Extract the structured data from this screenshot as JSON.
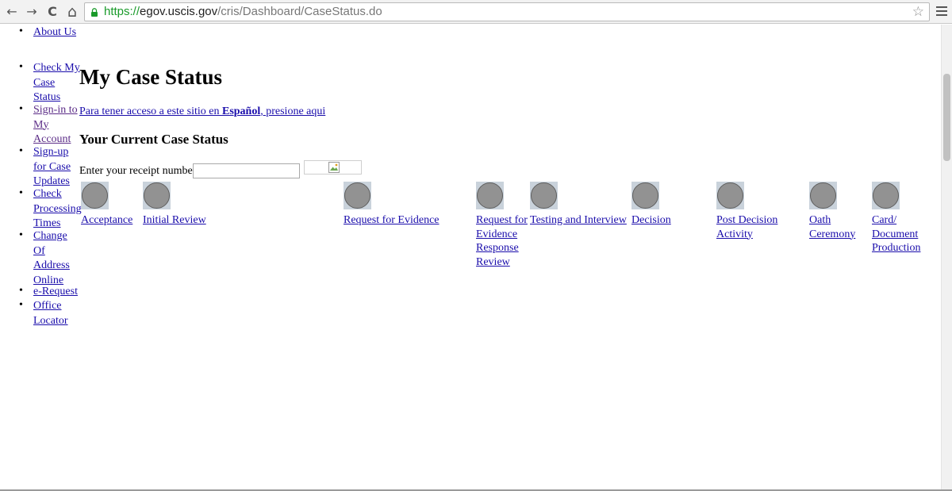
{
  "browser": {
    "url_scheme": "https://",
    "url_host": "egov.uscis.gov",
    "url_path": "/cris/Dashboard/CaseStatus.do",
    "icons": [
      "back-icon",
      "forward-icon",
      "reload-icon",
      "home-icon",
      "lock-icon",
      "bookmark-star-icon",
      "menu-icon"
    ],
    "back_glyph": "←",
    "forward_glyph": "→",
    "reload_glyph": "C",
    "home_glyph": "⌂",
    "star_glyph": "☆"
  },
  "nav": {
    "bullet": "•",
    "about_us": "About Us",
    "items": [
      {
        "lines": [
          "Check My",
          "Case",
          "Status"
        ]
      },
      {
        "lines": [
          "Sign-in to",
          "My",
          "Account"
        ]
      },
      {
        "lines": [
          "Sign-up",
          "for Case",
          "Updates"
        ]
      },
      {
        "lines": [
          "Check",
          "Processing",
          "Times"
        ]
      },
      {
        "lines": [
          "Change",
          "Of",
          "Address",
          "Online"
        ]
      },
      {
        "lines": [
          "e-Request"
        ]
      },
      {
        "lines": [
          "Office",
          "Locator"
        ]
      }
    ]
  },
  "main": {
    "title": "My Case Status",
    "spanish_prefix": "Para tener acceso a este sitio en ",
    "spanish_bold": "Español",
    "spanish_suffix": ", presione aqui",
    "section_title": "Your Current Case Status",
    "receipt_label": "Enter your receipt number",
    "receipt_value": "",
    "stages": [
      {
        "lines": [
          "Acceptance"
        ]
      },
      {
        "lines": [
          "Initial Review"
        ]
      },
      {
        "lines": [
          "Request for Evidence"
        ]
      },
      {
        "lines": [
          "Request for",
          "Evidence",
          "Response",
          "Review"
        ]
      },
      {
        "lines": [
          "Testing and Interview"
        ]
      },
      {
        "lines": [
          "Decision"
        ]
      },
      {
        "lines": [
          "Post Decision",
          "Activity"
        ]
      },
      {
        "lines": [
          "Oath",
          "Ceremony"
        ]
      },
      {
        "lines": [
          "Card/",
          "Document",
          "Production"
        ]
      }
    ]
  },
  "colors": {
    "link": "#1a0dab",
    "visited_link": "#5b2c87",
    "stage_circle": "#929292",
    "https_green": "#1a9a2a"
  }
}
